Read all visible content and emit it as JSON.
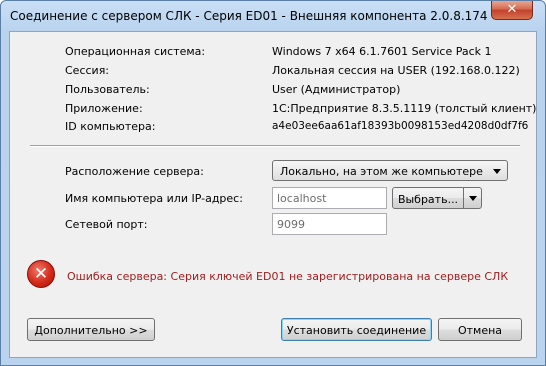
{
  "window": {
    "title": "Соединение с сервером СЛК - Серия ED01 - Внешняя компонента 2.0.8.174",
    "close_glyph": "✕"
  },
  "info": {
    "rows": [
      {
        "label": "Операционная система:",
        "value": "Windows 7 x64 6.1.7601 Service Pack 1"
      },
      {
        "label": "Сессия:",
        "value": "Локальная сессия на USER (192.168.0.122)"
      },
      {
        "label": "Пользователь:",
        "value": "User (Администратор)"
      },
      {
        "label": "Приложение:",
        "value": "1С:Предприятие 8.3.5.1119 (толстый клиент)"
      },
      {
        "label": "ID компьютера:",
        "value": "a4e03ee6aa61af18393b0098153ed4208d0df7f6"
      }
    ]
  },
  "settings": {
    "server_location_label": "Расположение сервера:",
    "server_location_value": "Локально, на этом же компьютере",
    "host_label": "Имя компьютера или IP-адрес:",
    "host_value": "localhost",
    "choose_button": "Выбрать...",
    "port_label": "Сетевой порт:",
    "port_value": "9099"
  },
  "error": {
    "icon": "✕",
    "message": "Ошибка сервера: Серия ключей ED01 не зарегистрирована на сервере СЛК"
  },
  "buttons": {
    "advanced": "Дополнительно >>",
    "connect": "Установить соединение",
    "cancel": "Отмена"
  },
  "colors": {
    "error_text": "#a01e1e",
    "error_icon": "#d42a1a",
    "frame": "#bad3ee"
  }
}
